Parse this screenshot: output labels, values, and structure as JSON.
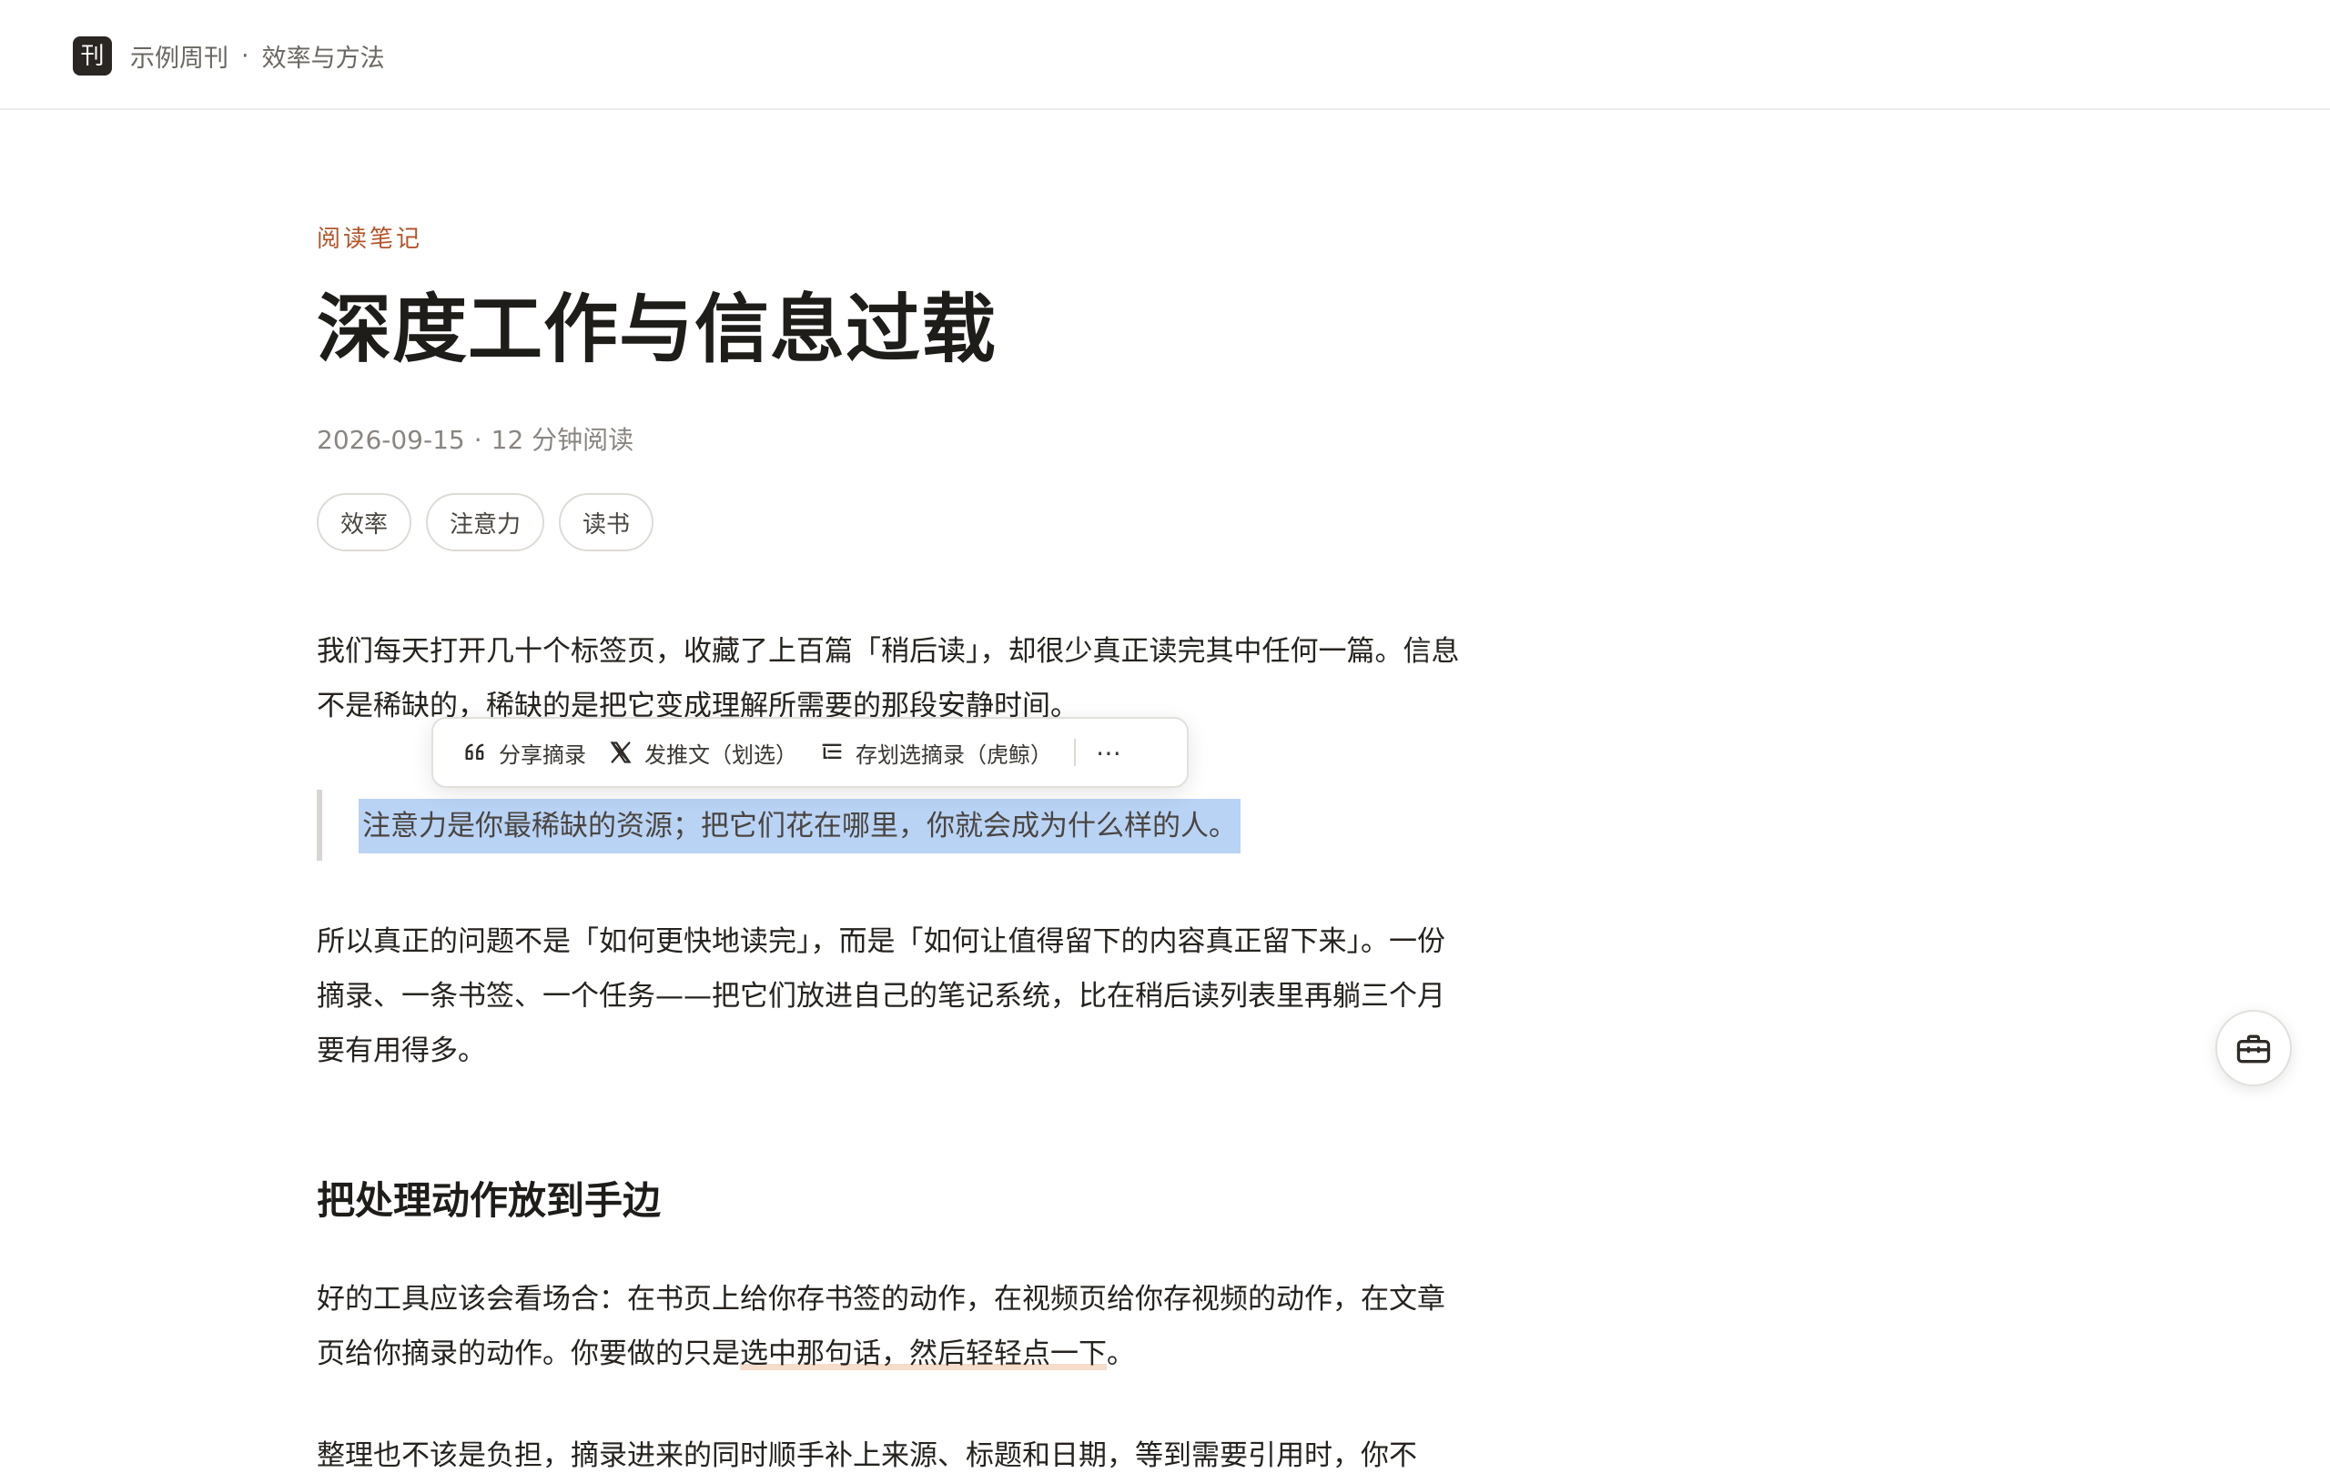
{
  "header": {
    "logo_char": "刊",
    "site_name": "示例周刊",
    "separator": "·",
    "section": "效率与方法"
  },
  "article": {
    "kicker": "阅读笔记",
    "title": "深度工作与信息过载",
    "date": "2026-09-15",
    "meta_sep": "·",
    "read_time": "12 分钟阅读",
    "tags": [
      "效率",
      "注意力",
      "读书"
    ],
    "p1": "我们每天打开几十个标签页，收藏了上百篇「稍后读」，却很少真正读完其中任何一篇。信息不是稀缺的，稀缺的是把它变成理解所需要的那段安静时间。",
    "quote": "注意力是你最稀缺的资源；把它们花在哪里，你就会成为什么样的人。",
    "p2": "所以真正的问题不是「如何更快地读完」，而是「如何让值得留下的内容真正留下来」。一份摘录、一条书签、一个任务——把它们放进自己的笔记系统，比在稍后读列表里再躺三个月要有用得多。",
    "subhead": "把处理动作放到手边",
    "p3_before": "好的工具应该会看场合：在书页上给你存书签的动作，在视频页给你存视频的动作，在文章页给你摘录的动作。你要做的只是",
    "p3_mark": "选中那句话，然后轻轻点一下",
    "p3_after": "。",
    "p4": "整理也不该是负担，摘录进来的同时顺手补上来源、标题和日期，等到需要引用时，你不"
  },
  "popup": {
    "share_label": "分享摘录",
    "tweet_label": "发推文（划选）",
    "save_label": "存划选摘录（虎鲸）",
    "more_label": "⋯"
  },
  "fab": {
    "icon": "toolbox-icon"
  }
}
